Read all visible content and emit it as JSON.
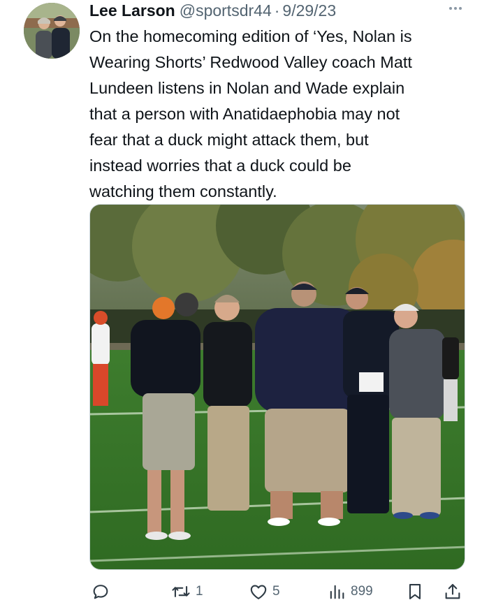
{
  "author": {
    "display_name": "Lee Larson",
    "handle": "@sportsdr44",
    "separator": "·",
    "date": "9/29/23",
    "avatar_icon": "profile-photo"
  },
  "tweet": {
    "text": "On the homecoming edition of ‘Yes, Nolan is\nWearing Shorts’ Redwood Valley coach Matt\nLundeen listens in Nolan and Wade explain\nthat a person with Anatidaephobia may not\nfear that a duck might attack them, but\ninstead worries that a duck could be\nwatching them constantly."
  },
  "media": {
    "icon": "photo-football-coaches-on-field"
  },
  "actions": {
    "reply": {
      "icon": "reply-icon",
      "count": ""
    },
    "retweet": {
      "icon": "retweet-icon",
      "count": "1"
    },
    "like": {
      "icon": "heart-icon",
      "count": "5"
    },
    "views": {
      "icon": "views-icon",
      "count": "899"
    },
    "bookmark": {
      "icon": "bookmark-icon"
    },
    "share": {
      "icon": "share-icon"
    }
  },
  "colors": {
    "primary_text": "#0f1419",
    "secondary_text": "#536471",
    "background": "#ffffff"
  }
}
